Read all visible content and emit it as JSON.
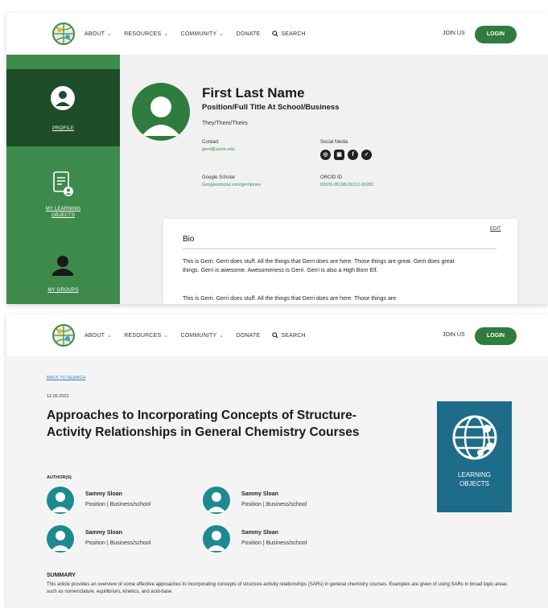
{
  "nav": {
    "items": [
      {
        "label": "ABOUT",
        "chevron": true
      },
      {
        "label": "RESOURCES",
        "chevron": true
      },
      {
        "label": "COMMUNITY",
        "chevron": true
      },
      {
        "label": "DONATE",
        "chevron": false
      }
    ],
    "search_label": "SEARCH",
    "join_label": "JOIN US",
    "login_label": "LOGIN",
    "chevron_glyph": "⌄"
  },
  "profile": {
    "sidebar": [
      {
        "label": "PROFILE",
        "icon": "user-icon",
        "active": true
      },
      {
        "label": "MY LEARNING OBJECTS",
        "icon": "document-user-icon",
        "active": false
      },
      {
        "label": "MY GROUPS",
        "icon": "group-icon",
        "active": false
      }
    ],
    "name": "First Last Name",
    "title": "Position/Full Title At School/Business",
    "pronouns": "They/Them/Theirs",
    "contact_label": "Contact",
    "contact_value": "gerri@usme.edu",
    "social_label": "Social Media",
    "social_icons": [
      "instagram-icon",
      "linkedin-icon",
      "facebook-icon",
      "twitter-icon"
    ],
    "scholar_label": "Google Scholar",
    "scholar_value": "Googlescholar.com/gerrijones",
    "orcid_label": "ORCID ID",
    "orcid_value": "00100-05198-09112-00282",
    "bio": {
      "edit_label": "EDIT",
      "title": "Bio",
      "paragraph1": "This is Gerri. Gerri does stuff. All the things that Gerri does are here. Those things are great. Gerri does great things. Gerri is awesome. Awesomeness is Gerri. Gerri is also a High Born Elf.",
      "paragraph2": "This is Gerri. Gerri does stuff. All the things that Gerri does are here. Those things are"
    }
  },
  "article": {
    "back_label": "BACK TO SEARCH",
    "date": "12.05.2022",
    "title": "Approaches to Incorporating Concepts of Structure-Activity Relationships in General Chemistry Courses",
    "authors_label": "AUTHOR(S)",
    "authors": [
      {
        "name": "Sammy Sloan",
        "position": "Position | Business/school"
      },
      {
        "name": "Sammy Sloan",
        "position": "Position | Business/school"
      },
      {
        "name": "Sammy Sloan",
        "position": "Position | Business/school"
      },
      {
        "name": "Sammy Sloan",
        "position": "Position | Business/school"
      }
    ],
    "badge_line1": "LEARNING",
    "badge_line2": "OBJECTS",
    "summary_label": "SUMMARY",
    "summary": "This article provides an overview of some effective approaches to incorporating concepts of structure-activity relationships (SARs) in general chemistry courses. Examples are given of using SARs in broad topic areas such as nomenclature, equilibrium, kinetics, and acid-base"
  },
  "colors": {
    "brand_green": "#2e7d3e",
    "sidebar_green": "#3d8a4c",
    "sidebar_active": "#1e4d2a",
    "badge_blue": "#1d6d8a",
    "avatar_teal": "#1d8a8f"
  }
}
